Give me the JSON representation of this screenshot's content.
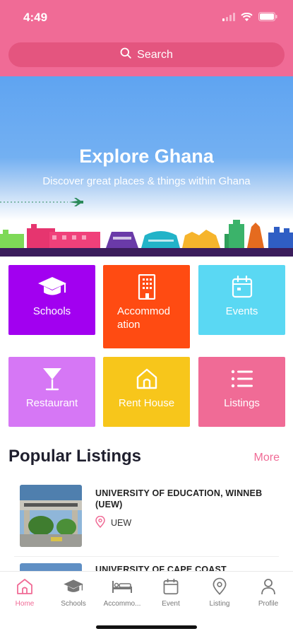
{
  "status_bar": {
    "time": "4:49"
  },
  "search": {
    "label": "Search"
  },
  "hero": {
    "title": "Explore Ghana",
    "subtitle": "Discover great places & things within Ghana"
  },
  "categories": [
    {
      "label": "Schools",
      "icon": "graduation-cap-icon",
      "color": "#a200f0"
    },
    {
      "label": "Accommod ation",
      "icon": "building-icon",
      "color": "#ff4b12"
    },
    {
      "label": "Events",
      "icon": "calendar-icon",
      "color": "#5ad8f3"
    },
    {
      "label": "Restaurant",
      "icon": "cocktail-glass-icon",
      "color": "#d677f5"
    },
    {
      "label": "Rent House",
      "icon": "house-icon",
      "color": "#f7c61b"
    },
    {
      "label": "Listings",
      "icon": "list-icon",
      "color": "#f06b96"
    }
  ],
  "popular": {
    "title": "Popular Listings",
    "more_label": "More",
    "items": [
      {
        "name": "UNIVERSITY OF EDUCATION, WINNEB (UEW)",
        "tag": "UEW"
      },
      {
        "name": "UNIVERSITY OF CAPE COAST",
        "tag": ""
      }
    ]
  },
  "tabbar": {
    "tabs": [
      {
        "label": "Home",
        "icon": "home-icon"
      },
      {
        "label": "Schools",
        "icon": "graduation-cap-icon"
      },
      {
        "label": "Accommo...",
        "icon": "bed-icon"
      },
      {
        "label": "Event",
        "icon": "calendar-icon"
      },
      {
        "label": "Listing",
        "icon": "location-pin-icon"
      },
      {
        "label": "Profile",
        "icon": "person-icon"
      }
    ],
    "active_color": "#f06b96"
  }
}
